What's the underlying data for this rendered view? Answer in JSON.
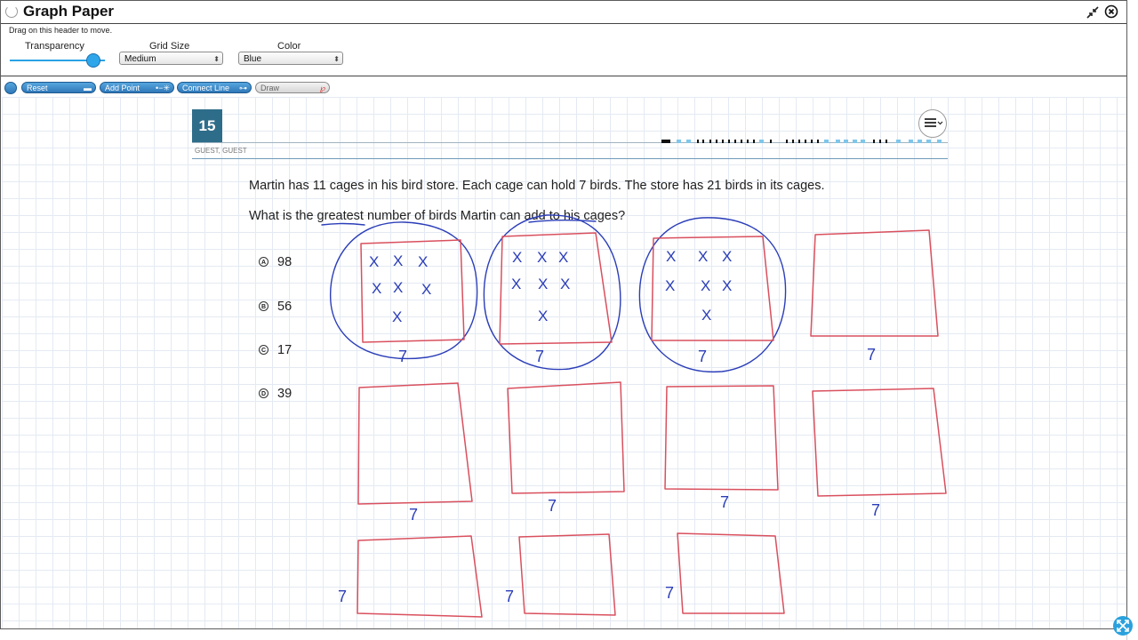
{
  "window": {
    "title": "Graph Paper",
    "drag_hint": "Drag on this header to move."
  },
  "controls": {
    "transparency_label": "Transparency",
    "transparency_value": 0.87,
    "grid_size_label": "Grid Size",
    "grid_size_value": "Medium",
    "color_label": "Color",
    "color_value": "Blue"
  },
  "toolbar": {
    "reset_label": "Reset",
    "add_point_label": "Add Point",
    "connect_line_label": "Connect Line",
    "draw_label": "Draw"
  },
  "question": {
    "number": "15",
    "user": "GUEST, GUEST",
    "text1": "Martin has 11 cages in his bird store. Each cage can hold 7 birds. The store has 21 birds in its cages.",
    "text2": "What is the greatest number of birds Martin can add to his cages?",
    "choices": [
      {
        "letter": "A",
        "value": "98"
      },
      {
        "letter": "B",
        "value": "56"
      },
      {
        "letter": "C",
        "value": "17"
      },
      {
        "letter": "D",
        "value": "39"
      }
    ]
  },
  "annotations": {
    "cage_label": "7",
    "bird_mark": "X",
    "ink_colors": {
      "cage": "#d9505e",
      "bird": "#2b3eb8"
    }
  },
  "colors": {
    "accent": "#2f78b8",
    "question_badge": "#2e6d8a"
  },
  "icons": {
    "spinner": "loading-spinner-icon",
    "compress": "compress-arrows-icon",
    "close": "close-circle-icon",
    "menu": "hamburger-menu-icon",
    "expand": "expand-arrows-icon"
  }
}
